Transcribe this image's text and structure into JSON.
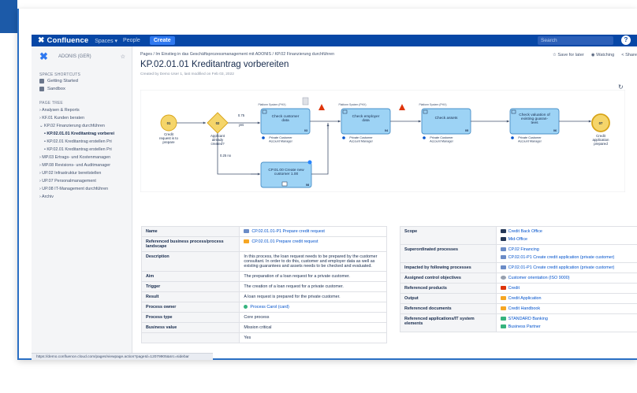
{
  "topbar": {
    "logo_label": "Confluence",
    "nav": [
      "Spaces ▾",
      "People"
    ],
    "create_label": "Create",
    "search_placeholder": "Search",
    "help_label": "?"
  },
  "sidebar": {
    "space_name": "ADONIS (GER)",
    "shortcuts_heading": "SPACE SHORTCUTS",
    "shortcuts": [
      "Getting Started",
      "Sandbox"
    ],
    "tree_heading": "PAGE TREE",
    "tree": [
      {
        "label": "› Analysen & Reports",
        "level": 1,
        "active": false
      },
      {
        "label": "› KF.01 Kunden beraten",
        "level": 1,
        "active": false
      },
      {
        "label": "⌄ KP.02 Finanzierung durchführen",
        "level": 1,
        "active": false
      },
      {
        "label": "• KP.02.01.01 Kreditantrag vorberei",
        "level": 2,
        "active": true
      },
      {
        "label": "• KP.02.01 Kreditantrag erstellen Pri",
        "level": 2,
        "active": false
      },
      {
        "label": "• KP.02.01 Kreditantrag erstellen Pri",
        "level": 2,
        "active": false
      },
      {
        "label": "› MP.03 Ertrags- und Kostenmanagen",
        "level": 1,
        "active": false
      },
      {
        "label": "› MP.08 Revisions- und Auditmanager",
        "level": 1,
        "active": false
      },
      {
        "label": "› UP.02 Infrastruktur bereitstellen",
        "level": 1,
        "active": false
      },
      {
        "label": "› UP.07 Personalmanagement",
        "level": 1,
        "active": false
      },
      {
        "label": "› UP.08 IT-Management durchführen",
        "level": 1,
        "active": false
      },
      {
        "label": "› Archiv",
        "level": 1,
        "active": false
      }
    ],
    "status_url": "https://demo.confluence.cloud.com/pages/viewpage.action?pageId=12079905&src=sidebar"
  },
  "page": {
    "breadcrumb": "Pages / Im Einstieg in das Geschäftsprozessmanagement mit ADONIS / KP.02 Finanzierung durchführen",
    "title": "KP.02.01.01 Kreditantrag vorbereiten",
    "byline": "Created by Demo User 1, last modified on Feb 03, 2022",
    "actions": [
      "☆ Save for later",
      "◉ Watching",
      "< Share"
    ]
  },
  "diagram": {
    "start_event": {
      "id": "01",
      "label": [
        "Credit",
        "request is to",
        "prepare"
      ]
    },
    "gateway": {
      "id": "02",
      "label": [
        "Applicant",
        "already",
        "created?"
      ]
    },
    "edge_yes": {
      "prob": "0.75",
      "label": "yes"
    },
    "edge_no": {
      "prob": "0.25",
      "label": "no"
    },
    "tasks": [
      {
        "id": "03",
        "pool": "Platform System (PHX)",
        "name": [
          "Check customer",
          "data"
        ],
        "role": [
          "Private Customer",
          "Account Manager"
        ]
      },
      {
        "id": "04",
        "pool": "Platform System (PHX)",
        "name": [
          "Check employer",
          "data"
        ],
        "role": [
          "Private Customer",
          "Account Manager"
        ]
      },
      {
        "id": "05",
        "pool": "Platform System (PHX)",
        "name": [
          "Check assets"
        ],
        "role": [
          "Private Customer",
          "Account Manager"
        ]
      },
      {
        "id": "06",
        "pool": "",
        "name": [
          "Check valuation of",
          "existing guaran-",
          "tees"
        ],
        "role": [
          "Private Customer",
          "Account Manager"
        ]
      }
    ],
    "subprocess": {
      "id": "08",
      "name": [
        "CP.01.00 Create new",
        "customer 1.00"
      ]
    },
    "end_event": {
      "id": "07",
      "label": [
        "Credit",
        "application",
        "prepared"
      ]
    }
  },
  "details_left": [
    {
      "key": "Name",
      "value": "CP.02.01.01-P1 Prepare credit request",
      "link": true,
      "chip": "blue"
    },
    {
      "key": "Referenced business process/process landscape",
      "value": "CP.02.01.01 Prepare credit request",
      "link": true,
      "chip": "orange"
    },
    {
      "key": "Description",
      "value": "In this process, the loan request needs to be prepared by the customer consultant. In order to do this, customer and employer data as well as existing guarantees and assets needs to be checked and evaluated.",
      "link": false,
      "chip": ""
    },
    {
      "key": "Aim",
      "value": "The preparation of a loan request for a private customer.",
      "link": false,
      "chip": ""
    },
    {
      "key": "Trigger",
      "value": "The creation of a loan request for a private customer.",
      "link": false,
      "chip": ""
    },
    {
      "key": "Result",
      "value": "A loan request is prepared for the private customer.",
      "link": false,
      "chip": ""
    },
    {
      "key": "Process owner",
      "value": "Process Carol (card)",
      "link": true,
      "chip": "person"
    },
    {
      "key": "Process type",
      "value": "Core process",
      "link": false,
      "chip": ""
    },
    {
      "key": "Business value",
      "value": "Mission critical",
      "link": false,
      "chip": ""
    },
    {
      "key": "",
      "value": "Yes",
      "link": false,
      "chip": ""
    }
  ],
  "details_right": [
    {
      "key": "Scope",
      "values": [
        {
          "t": "Credit Back Office",
          "chip": "navy"
        },
        {
          "t": "Mid-Office",
          "chip": "navy"
        }
      ]
    },
    {
      "key": "Superordinated processes",
      "values": [
        {
          "t": "CP.02 Financing",
          "chip": "blue"
        },
        {
          "t": "CP.02.01-P1 Create credit application (private customer)",
          "chip": "blue"
        }
      ]
    },
    {
      "key": "Impacted by following processes",
      "values": [
        {
          "t": "CP.02.01-P1 Create credit application (private customer)",
          "chip": "blue"
        }
      ]
    },
    {
      "key": "Assigned control objectives",
      "values": [
        {
          "t": "Customer orientation (ISO 9000)",
          "chip": "gray"
        }
      ]
    },
    {
      "key": "Referenced products",
      "values": [
        {
          "t": "Credit",
          "chip": "red"
        }
      ]
    },
    {
      "key": "Output",
      "values": [
        {
          "t": "Credit Application",
          "chip": "orange"
        }
      ]
    },
    {
      "key": "Referenced documents",
      "values": [
        {
          "t": "Credit Handbook",
          "chip": "orange"
        }
      ]
    },
    {
      "key": "Referenced applications/IT system elements",
      "values": [
        {
          "t": "STANDARD Banking",
          "chip": "green"
        },
        {
          "t": "Business Partner",
          "chip": "green"
        }
      ]
    }
  ]
}
